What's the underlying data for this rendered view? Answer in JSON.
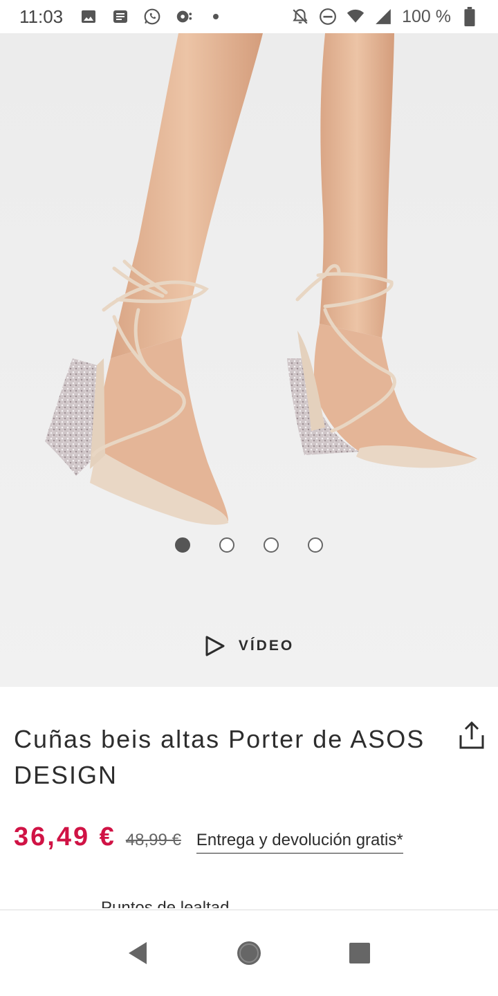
{
  "status_bar": {
    "time": "11:03",
    "battery": "100 %",
    "icons_left": [
      "image-icon",
      "news-icon",
      "whatsapp-icon",
      "podcast-icon",
      "dot-icon"
    ],
    "icons_right": [
      "bell-off-icon",
      "do-not-disturb-icon",
      "wifi-icon",
      "signal-icon",
      "battery-icon"
    ]
  },
  "gallery": {
    "image_count": 4,
    "active_index": 0,
    "video_label": "VÍDEO"
  },
  "product": {
    "title": "Cuñas beis altas Porter de ASOS DESIGN",
    "price": "36,49 €",
    "old_price": "48,99 €",
    "delivery": "Entrega y devolución gratis*",
    "next_section_partial": "Puntos de lealtad"
  },
  "colors": {
    "price": "#d01345",
    "text": "#2d2d2d",
    "hero_background": "#efefef"
  },
  "navbar": {
    "buttons": [
      "back-icon",
      "home-icon",
      "recents-icon"
    ]
  }
}
